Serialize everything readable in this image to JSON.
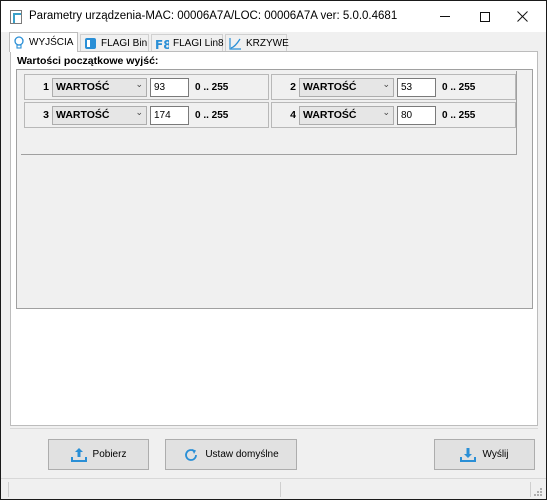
{
  "window": {
    "title": "Parametry urządzenia-MAC: 00006A7A/LOC: 00006A7A ver: 5.0.0.4681",
    "minimize_icon": "minimize-icon",
    "maximize_icon": "maximize-icon",
    "close_icon": "close-icon"
  },
  "tabs": [
    {
      "label": "WYJŚCIA",
      "icon": "bulb-icon",
      "active": true
    },
    {
      "label": "FLAGI Bin",
      "icon": "flag-bin-icon",
      "active": false
    },
    {
      "label": "FLAGI Lin8",
      "icon": "f8-icon",
      "active": false
    },
    {
      "label": "KRZYWE",
      "icon": "curve-icon",
      "active": false
    }
  ],
  "section_title": "Wartości początkowe wyjść:",
  "outputs": [
    {
      "number": "1",
      "mode": "WARTOŚĆ",
      "value": "93",
      "range": "0 .. 255"
    },
    {
      "number": "2",
      "mode": "WARTOŚĆ",
      "value": "53",
      "range": "0 .. 255"
    },
    {
      "number": "3",
      "mode": "WARTOŚĆ",
      "value": "174",
      "range": "0 .. 255"
    },
    {
      "number": "4",
      "mode": "WARTOŚĆ",
      "value": "80",
      "range": "0 .. 255"
    }
  ],
  "buttons": {
    "pobierz": "Pobierz",
    "ustaw_domyslne": "Ustaw domyślne",
    "wyslij": "Wyślij"
  },
  "colors": {
    "accent_blue": "#2a8fd6",
    "window_bg": "#f0f0f0"
  }
}
